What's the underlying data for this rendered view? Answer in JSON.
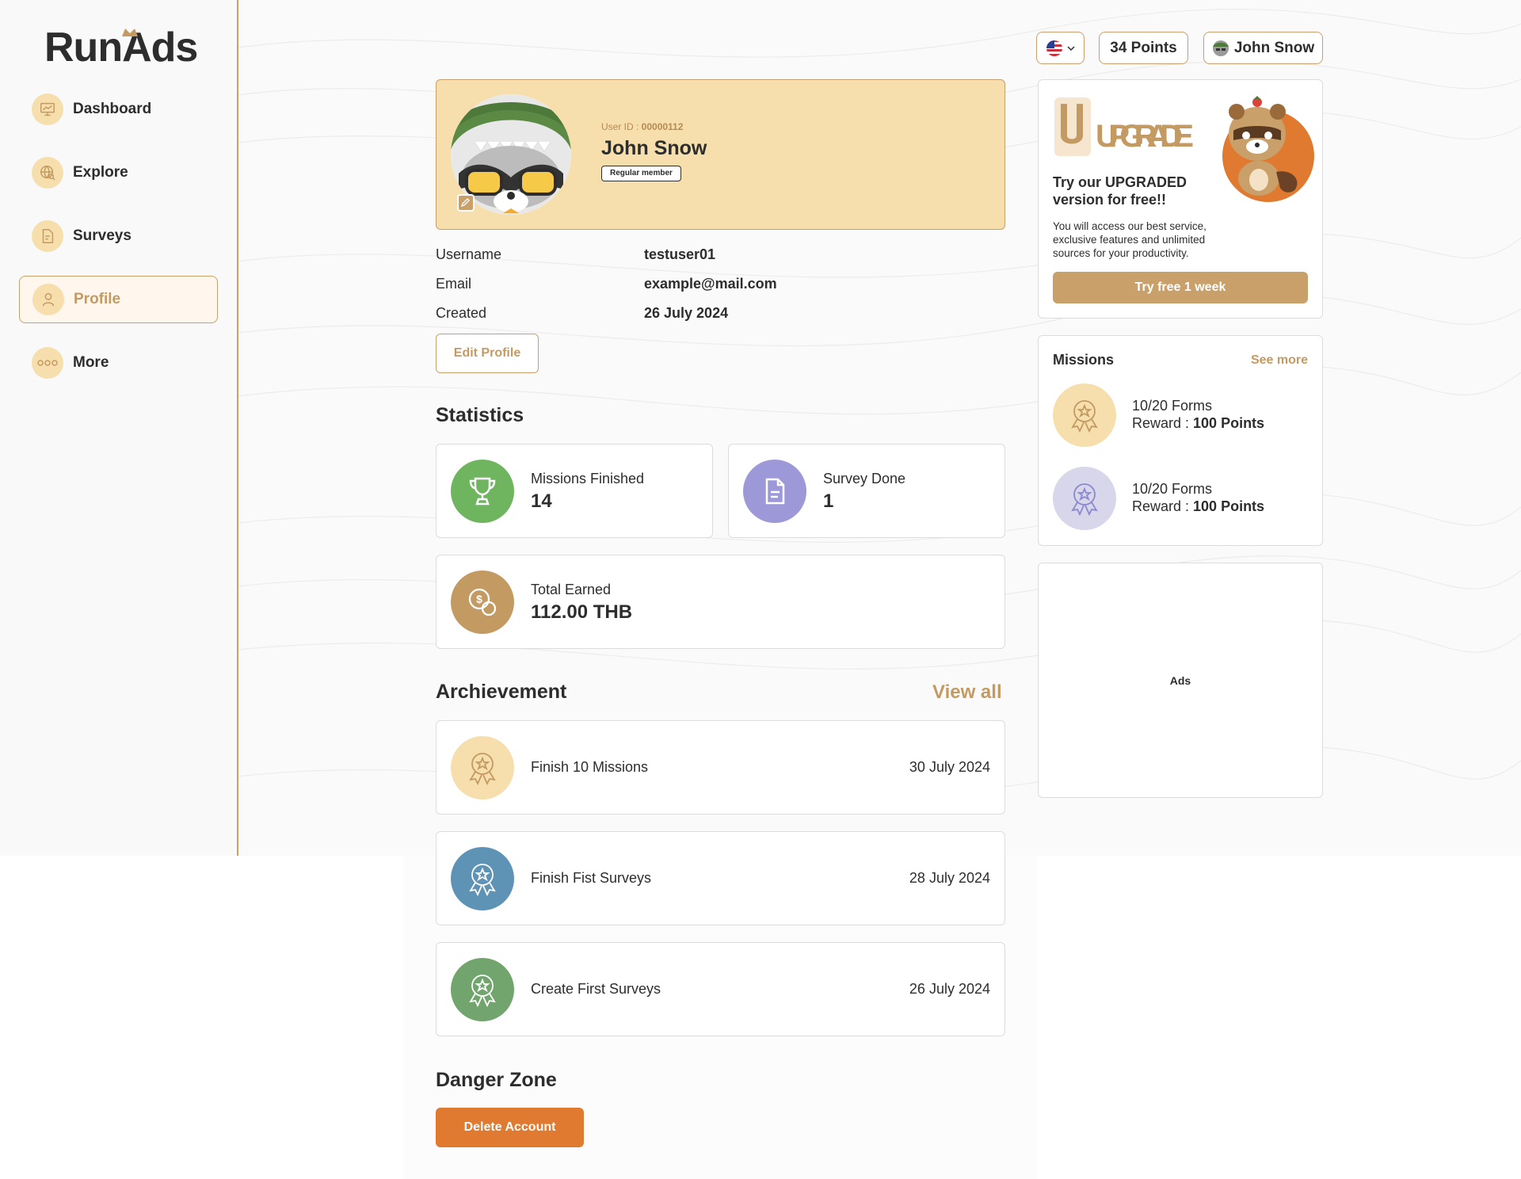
{
  "brand": {
    "logo_text": "RunAds"
  },
  "sidebar": {
    "items": [
      {
        "label": "Dashboard",
        "icon": "presentation-chart-icon"
      },
      {
        "label": "Explore",
        "icon": "globe-search-icon"
      },
      {
        "label": "Surveys",
        "icon": "document-icon"
      },
      {
        "label": "Profile",
        "icon": "user-icon",
        "active": true
      },
      {
        "label": "More",
        "icon": "more-dots-icon"
      }
    ]
  },
  "header": {
    "language_flag": "us-flag-icon",
    "points": "34 Points",
    "user_name": "John Snow"
  },
  "profile": {
    "user_id_label": "User ID : ",
    "user_id": "00000112",
    "name": "John Snow",
    "membership": "Regular member",
    "fields": [
      {
        "label": "Username",
        "value": "testuser01"
      },
      {
        "label": "Email",
        "value": "example@mail.com"
      },
      {
        "label": "Created",
        "value": "26 July 2024"
      }
    ],
    "edit_button": "Edit Profile"
  },
  "statistics": {
    "title": "Statistics",
    "items": [
      {
        "label": "Missions Finished",
        "value": "14",
        "icon": "trophy-icon",
        "color": "#6fb560"
      },
      {
        "label": "Survey Done",
        "value": "1",
        "icon": "document-icon",
        "color": "#9d99d8"
      },
      {
        "label": "Total Earned",
        "value": "112.00 THB",
        "icon": "coins-icon",
        "color": "#c49a63"
      }
    ]
  },
  "achievements": {
    "title": "Archievement",
    "view_all": "View all",
    "items": [
      {
        "title": "Finish 10 Missions",
        "date": "30 July 2024",
        "color": "#f6dfac",
        "icon_color": "#c49a63"
      },
      {
        "title": "Finish Fist Surveys",
        "date": "28 July 2024",
        "color": "#5e93b5",
        "icon_color": "#ffffff"
      },
      {
        "title": "Create First Surveys",
        "date": "26 July 2024",
        "color": "#72a56d",
        "icon_color": "#ffffff"
      }
    ]
  },
  "danger": {
    "title": "Danger Zone",
    "delete_button": "Delete Account"
  },
  "upgrade": {
    "word": "UPGRADE",
    "headline": "Try our UPGRADED version for free!!",
    "description": "You will access our best service, exclusive features and unlimited sources for your productivity.",
    "button": "Try free 1 week"
  },
  "missions": {
    "title": "Missions",
    "see_more": "See more",
    "items": [
      {
        "progress": "10/20 Forms",
        "reward_label": "Reward : ",
        "reward_value": "100 Points",
        "color": "#f6dfac",
        "icon_color": "#c49a63"
      },
      {
        "progress": "10/20 Forms",
        "reward_label": "Reward : ",
        "reward_value": "100 Points",
        "color": "#d8d6ea",
        "icon_color": "#8c88cf"
      }
    ]
  },
  "ads": {
    "label": "Ads"
  }
}
